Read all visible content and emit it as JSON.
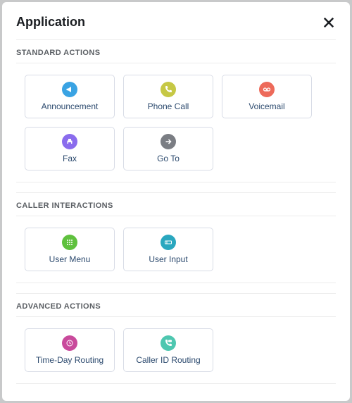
{
  "header": {
    "title": "Application"
  },
  "sections": {
    "standard": {
      "heading": "STANDARD ACTIONS",
      "items": {
        "announcement": {
          "label": "Announcement"
        },
        "phone_call": {
          "label": "Phone Call"
        },
        "voicemail": {
          "label": "Voicemail"
        },
        "fax": {
          "label": "Fax"
        },
        "goto": {
          "label": "Go To"
        }
      }
    },
    "caller": {
      "heading": "CALLER INTERACTIONS",
      "items": {
        "user_menu": {
          "label": "User Menu"
        },
        "user_input": {
          "label": "User Input"
        }
      }
    },
    "advanced": {
      "heading": "ADVANCED ACTIONS",
      "items": {
        "time_day_routing": {
          "label": "Time-Day Routing"
        },
        "caller_id_routing": {
          "label": "Caller ID Routing"
        }
      }
    }
  }
}
